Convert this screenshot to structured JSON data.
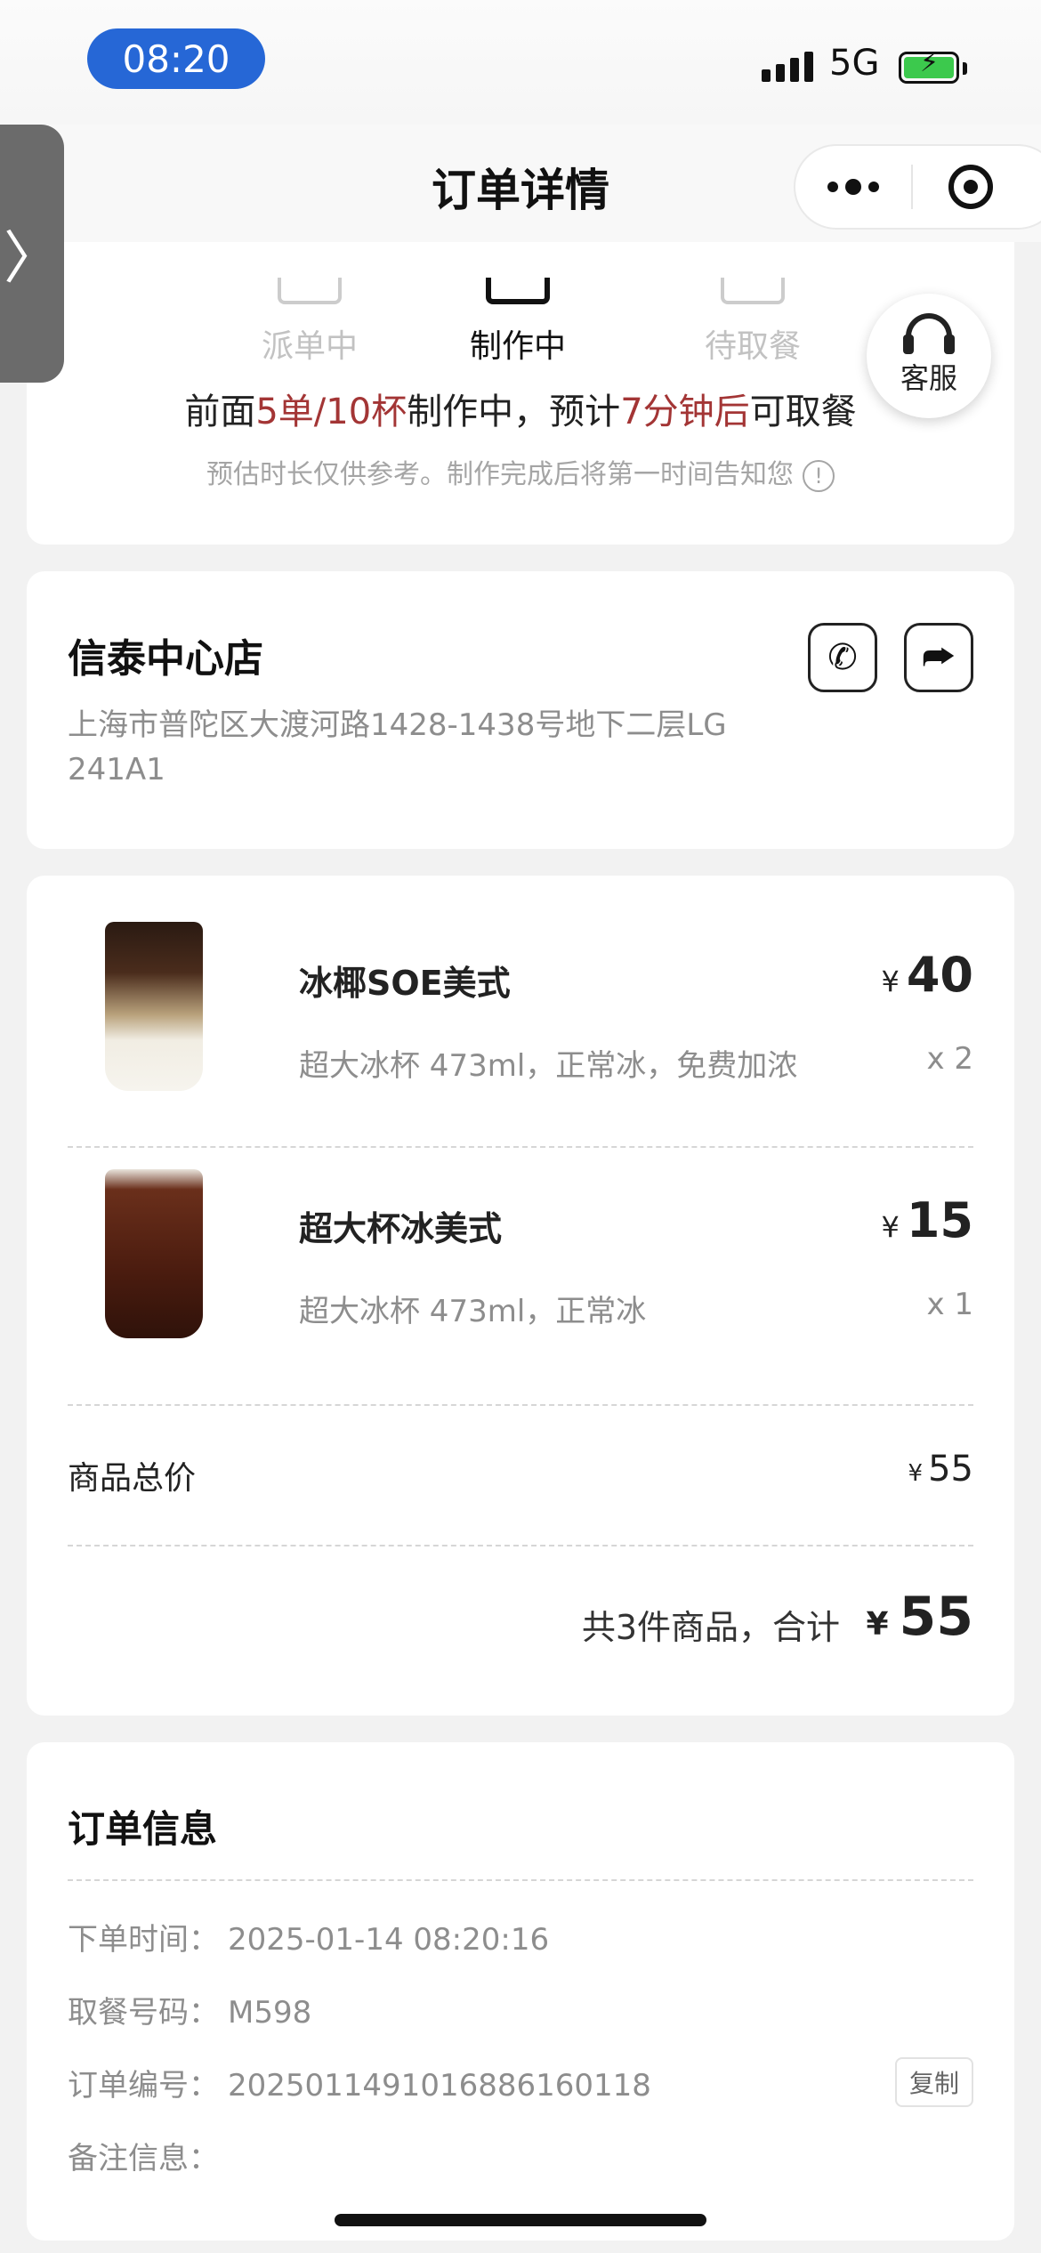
{
  "status_bar": {
    "time": "08:20",
    "network": "5G"
  },
  "header": {
    "back": "‹",
    "title": "订单详情"
  },
  "side_tab": {
    "label": "〉"
  },
  "progress": {
    "steps": [
      {
        "label": "派单中",
        "state": "done"
      },
      {
        "label": "制作中",
        "state": "active"
      },
      {
        "label": "待取餐",
        "state": "todo"
      }
    ],
    "eta_prefix": "前面",
    "queue": "5单/10杯",
    "eta_mid": "制作中，预计",
    "eta_time": "7分钟后",
    "eta_suffix": "可取餐",
    "note": "预估时长仅供参考。制作完成后将第一时间告知您",
    "info_icon": "!"
  },
  "customer_service": {
    "label": "客服"
  },
  "store": {
    "name": "信泰中心店",
    "address": "上海市普陀区大渡河路1428-1438号地下二层LG 241A1",
    "phone_icon": "✆",
    "nav_icon": "⮫"
  },
  "items": [
    {
      "name": "冰椰SOE美式",
      "spec": "超大冰杯 473ml，正常冰，免费加浓",
      "currency": "¥",
      "price": "40",
      "qty": "x 2"
    },
    {
      "name": "超大杯冰美式",
      "spec": "超大冰杯 473ml，正常冰",
      "currency": "¥",
      "price": "15",
      "qty": "x 1"
    }
  ],
  "summary": {
    "subtotal_label": "商品总价",
    "subtotal_currency": "¥",
    "subtotal": "55",
    "total_text": "共3件商品，合计",
    "total_currency": "¥",
    "total": "55"
  },
  "order_info": {
    "title": "订单信息",
    "rows": [
      {
        "label": "下单时间：",
        "value": "2025-01-14 08:20:16"
      },
      {
        "label": "取餐号码：",
        "value": "M598"
      },
      {
        "label": "订单编号：",
        "value": "20250114910168861601​18"
      },
      {
        "label": "备注信息：",
        "value": ""
      }
    ],
    "copy_label": "复制"
  },
  "colors": {
    "accent_red": "#a33535",
    "time_pill": "#2667d6",
    "battery": "#3cc94d"
  }
}
